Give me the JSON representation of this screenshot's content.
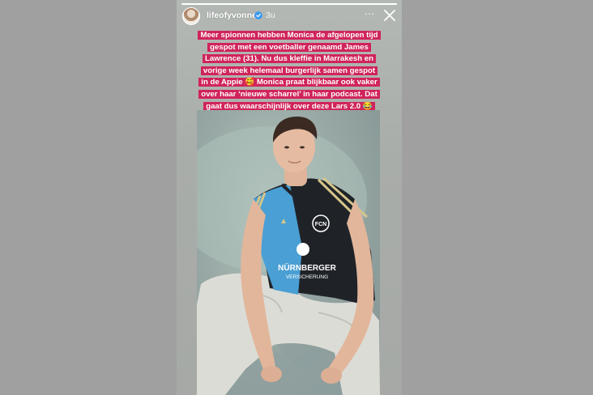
{
  "story": {
    "username": "lifeofyvonne",
    "time": "3u",
    "progress": 1.0,
    "caption_lines": [
      "Meer spionnen hebben Monica de afgelopen tijd",
      "gespot met een voetballer genaamd James",
      "Lawrence (31). Nu dus kleffie in Marrakesh en",
      "vorige week helemaal burgerlijk samen gespot",
      "in de Appie 🥰 Monica praat blijkbaar ook vaker",
      "over haar ‘nieuwe scharrel’ in haar podcast. Dat",
      "gaat dus waarschijnlijk over deze Lars 2.0 😂"
    ],
    "more_label": "···",
    "jersey": {
      "sponsor_line1": "NÜRNBERGER",
      "sponsor_line2": "VERSICHERUNG",
      "crest": "FCN"
    }
  },
  "colors": {
    "caption_bg": "#d0245a",
    "backdrop": "#a0a0a0"
  },
  "icons": {
    "verified": "verified-badge-icon",
    "more": "more-options-icon",
    "close": "close-icon"
  }
}
